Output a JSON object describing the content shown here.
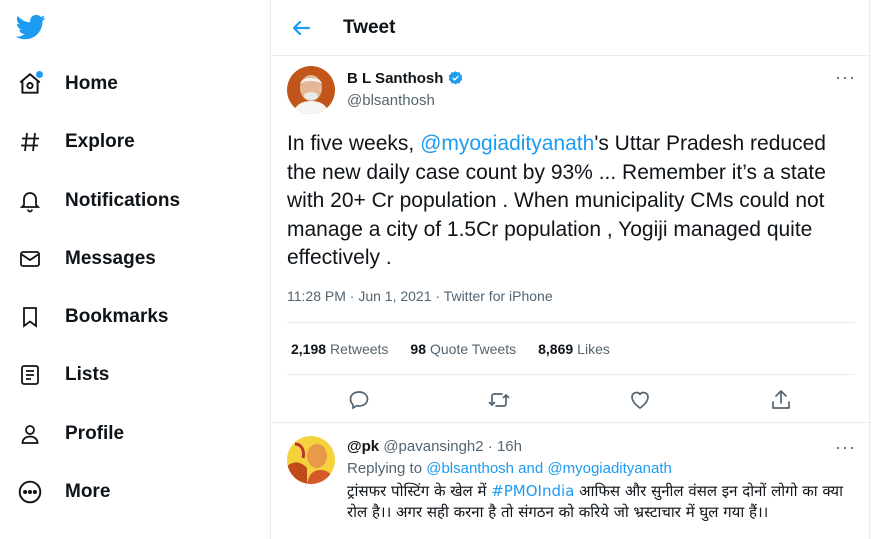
{
  "sidebar": {
    "items": [
      {
        "label": "Home",
        "icon": "home-icon"
      },
      {
        "label": "Explore",
        "icon": "hashtag-icon"
      },
      {
        "label": "Notifications",
        "icon": "bell-icon"
      },
      {
        "label": "Messages",
        "icon": "envelope-icon"
      },
      {
        "label": "Bookmarks",
        "icon": "bookmark-icon"
      },
      {
        "label": "Lists",
        "icon": "list-icon"
      },
      {
        "label": "Profile",
        "icon": "person-icon"
      },
      {
        "label": "More",
        "icon": "more-circle-icon"
      }
    ]
  },
  "header": {
    "title": "Tweet"
  },
  "tweet": {
    "author_name": "B L Santhosh",
    "author_handle": "@blsanthosh",
    "text_1": "In five weeks, ",
    "mention": "@myogiadityanath",
    "text_2": "'s Uttar Pradesh reduced the new daily case count by 93% ... Remember it’s a state with 20+ Cr population . When municipality CMs could not manage a city of 1.5Cr population , Yogiji managed quite effectively .",
    "meta": "11:28 PM · Jun 1, 2021 · Twitter for iPhone",
    "retweets_count": "2,198",
    "retweets_label": "Retweets",
    "quotes_count": "98",
    "quotes_label": "Quote Tweets",
    "likes_count": "8,869",
    "likes_label": "Likes"
  },
  "reply": {
    "name": "@pk",
    "handle": "@pavansingh2",
    "time": "· 16h",
    "replying_label": "Replying to",
    "replying_to_1": "@blsanthosh",
    "replying_and": "and",
    "replying_to_2": "@myogiadityanath",
    "text_1": "ट्रांसफर पोस्टिंग के खेल में ",
    "hashtag": "#PMOIndia",
    "text_2": " आफिस और सुनील वंसल इन दोनों लोगो का क्या रोल है।। अगर सही करना है तो संगठन को करिये जो भ्रस्टाचार में घुल गया हैं।।"
  },
  "colors": {
    "accent": "#1d9bf0",
    "text": "#0f1419",
    "secondary": "#536471",
    "border": "#e6ecf0"
  }
}
